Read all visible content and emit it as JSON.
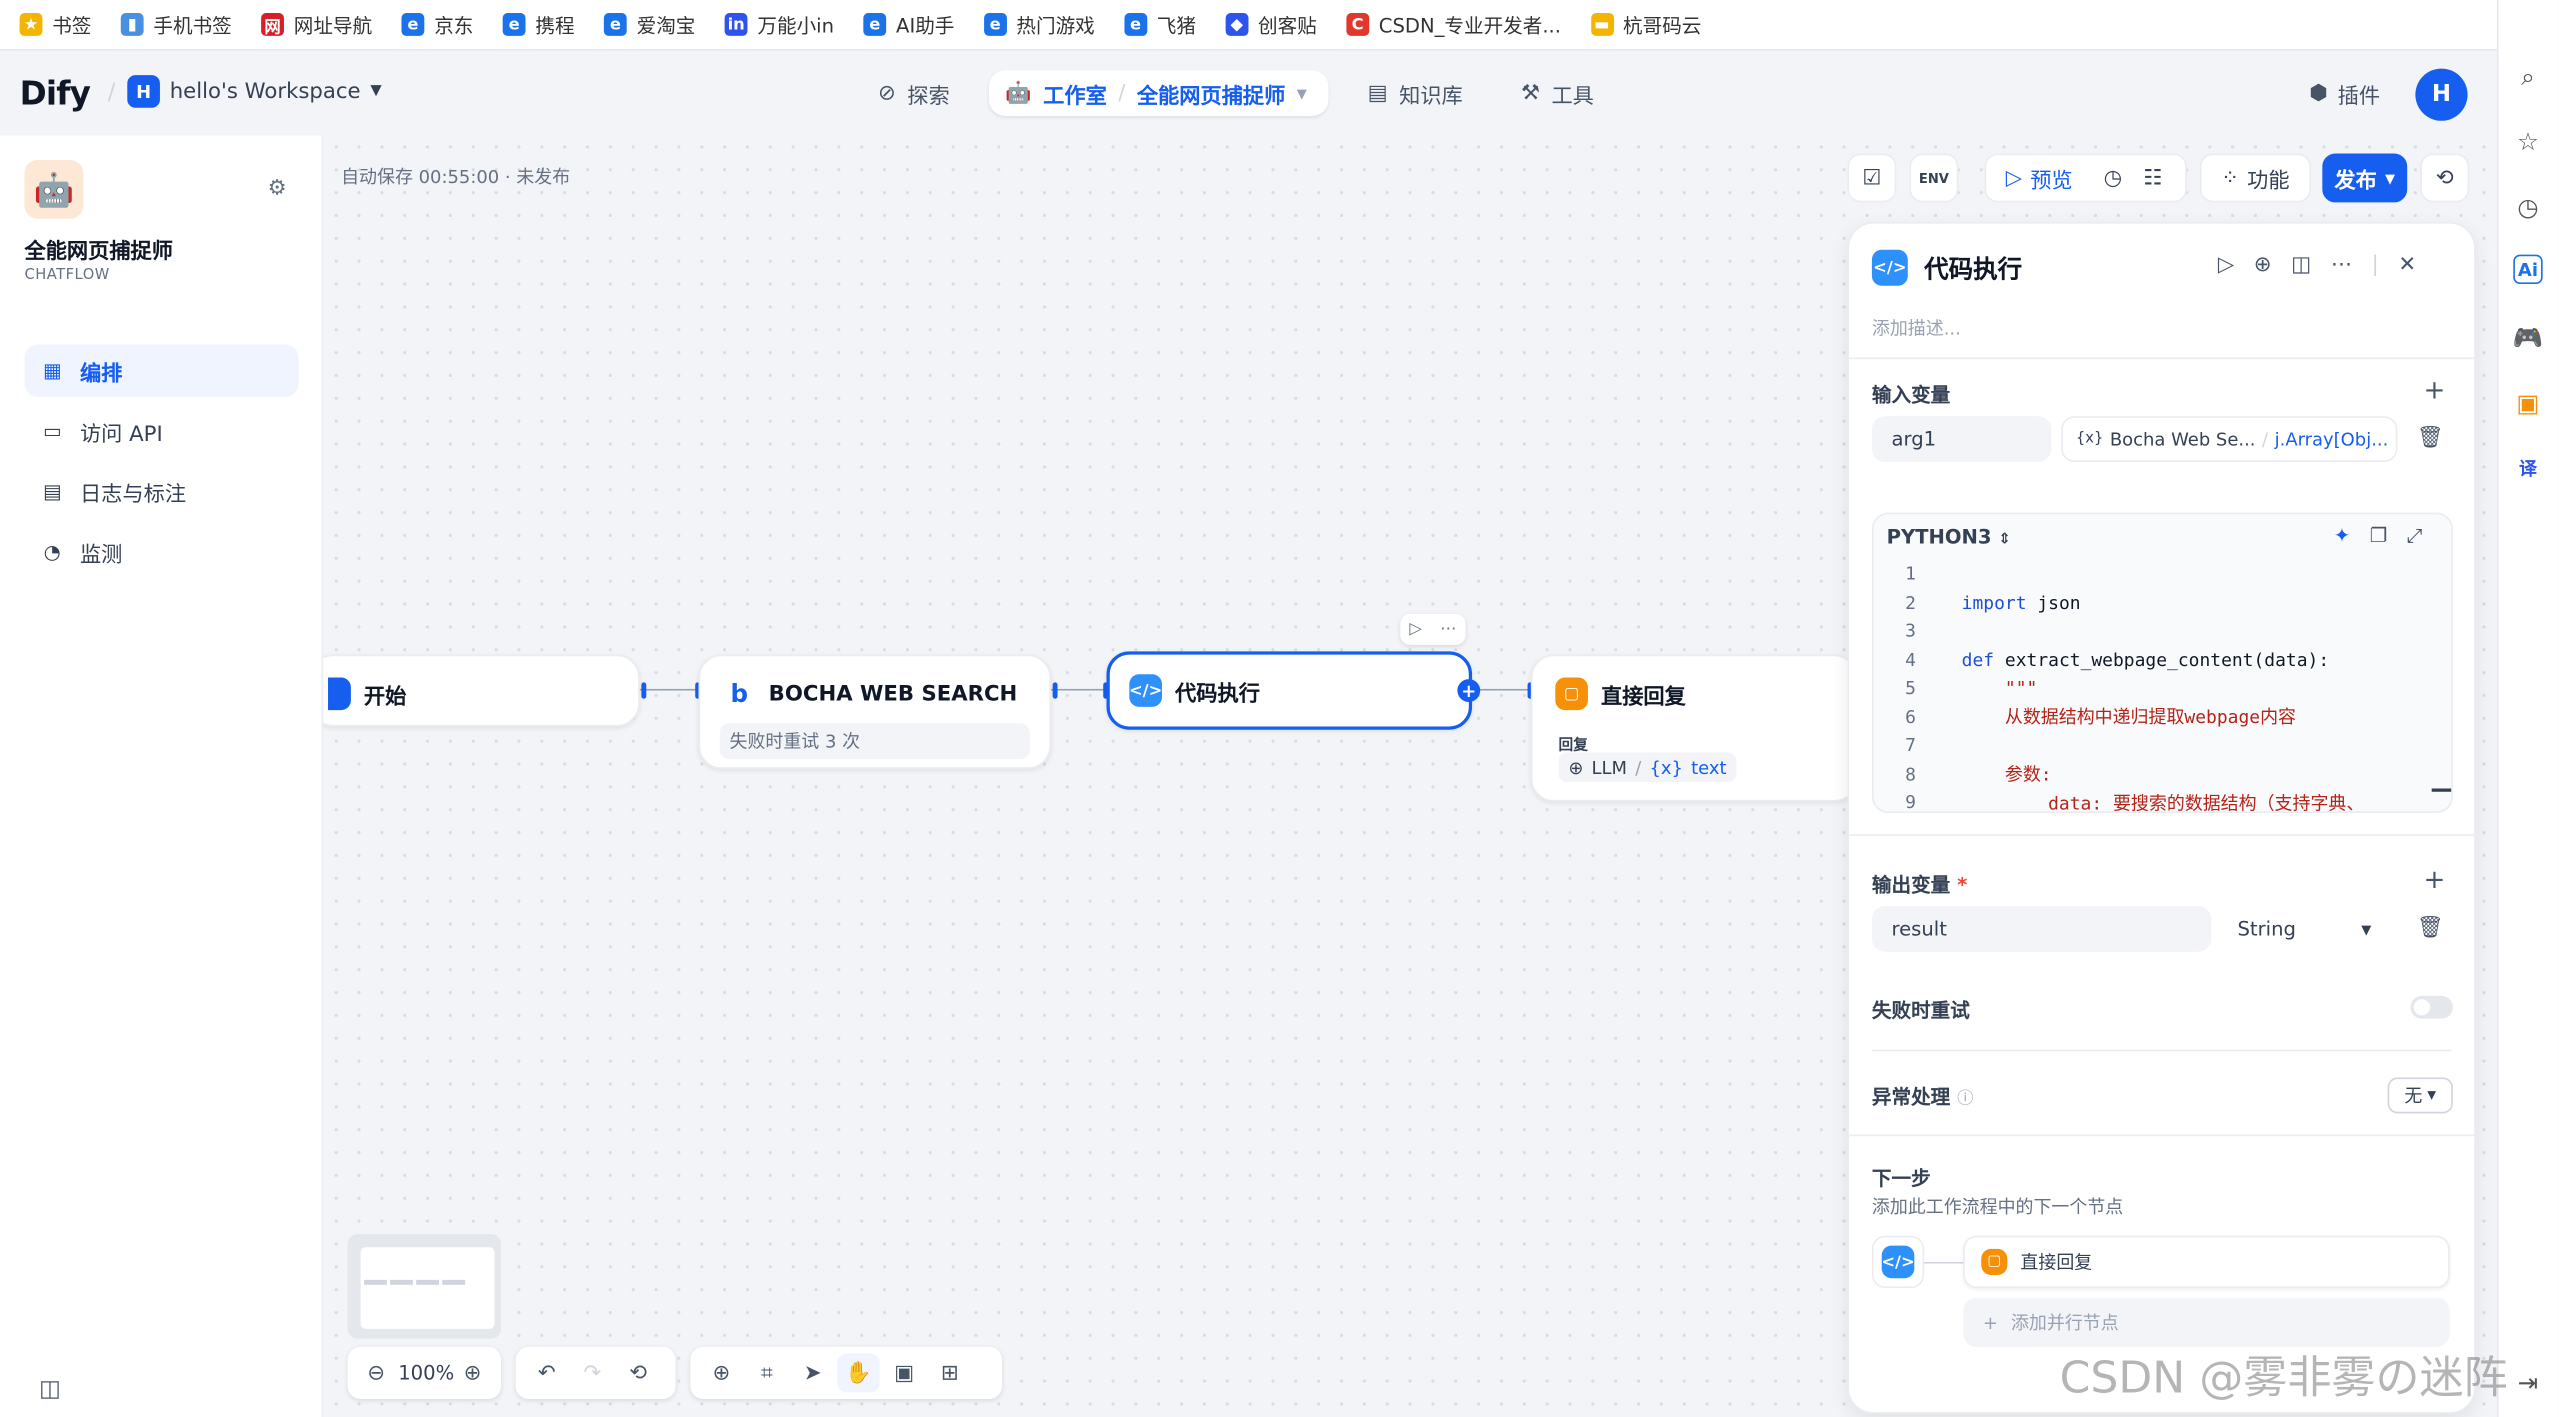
{
  "bookmarks": [
    {
      "label": "书签",
      "color": "#f5b400",
      "glyph": "★"
    },
    {
      "label": "手机书签",
      "color": "#4a90e2",
      "glyph": "▮"
    },
    {
      "label": "网址导航",
      "color": "#d91f26",
      "glyph": "网"
    },
    {
      "label": "京东",
      "color": "#1a73e8",
      "glyph": "e"
    },
    {
      "label": "携程",
      "color": "#1a73e8",
      "glyph": "e"
    },
    {
      "label": "爱淘宝",
      "color": "#1a73e8",
      "glyph": "e"
    },
    {
      "label": "万能小in",
      "color": "#2f54eb",
      "glyph": "in"
    },
    {
      "label": "AI助手",
      "color": "#1a73e8",
      "glyph": "e"
    },
    {
      "label": "热门游戏",
      "color": "#1a73e8",
      "glyph": "e"
    },
    {
      "label": "飞猪",
      "color": "#1a73e8",
      "glyph": "e"
    },
    {
      "label": "创客贴",
      "color": "#2f54eb",
      "glyph": "◆"
    },
    {
      "label": "CSDN_专业开发者...",
      "color": "#e0382c",
      "glyph": "C"
    },
    {
      "label": "杭哥码云",
      "color": "#f5b400",
      "glyph": "▬"
    }
  ],
  "header": {
    "logo": "Dify",
    "workspace_badge": "H",
    "workspace_name": "hello's Workspace",
    "nav": {
      "explore": "探索",
      "studio": "工作室",
      "current_app": "全能网页捕捉师",
      "knowledge": "知识库",
      "tools": "工具"
    },
    "plugins": "插件",
    "avatar": "H"
  },
  "sidebar": {
    "app_name": "全能网页捕捉师",
    "app_type": "CHATFLOW",
    "items": [
      {
        "label": "编排"
      },
      {
        "label": "访问 API"
      },
      {
        "label": "日志与标注"
      },
      {
        "label": "监测"
      }
    ]
  },
  "canvas": {
    "autosave": "自动保存 00:55:00 · 未发布",
    "nodes": {
      "start": {
        "title": "开始"
      },
      "bocha": {
        "title": "BOCHA WEB SEARCH",
        "sub": "失败时重试 3 次"
      },
      "code": {
        "title": "代码执行"
      },
      "answer": {
        "title": "直接回复",
        "reply_label": "回复",
        "ref_llm": "LLM",
        "ref_var": "text"
      }
    },
    "zoom": "100%"
  },
  "controls": {
    "preview": "预览",
    "features": "功能",
    "publish": "发布"
  },
  "panel": {
    "title": "代码执行",
    "desc_placeholder": "添加描述...",
    "input_label": "输入变量",
    "input_var": "arg1",
    "input_ref_node": "Bocha Web Se...",
    "input_ref_path": "j.Array[Obj...",
    "code_lang": "PYTHON3",
    "code_lines": [
      {
        "n": "1",
        "t": ""
      },
      {
        "n": "2",
        "t": "import json",
        "cls": "import"
      },
      {
        "n": "3",
        "t": ""
      },
      {
        "n": "4",
        "t": "def extract_webpage_content(data):",
        "cls": "def"
      },
      {
        "n": "5",
        "t": "    \"\"\"",
        "cls": "str"
      },
      {
        "n": "6",
        "t": "    从数据结构中递归提取webpage内容",
        "cls": "str"
      },
      {
        "n": "7",
        "t": ""
      },
      {
        "n": "8",
        "t": "    参数:",
        "cls": "str"
      },
      {
        "n": "9",
        "t": "        data: 要搜索的数据结构（支持字典、",
        "cls": "str"
      }
    ],
    "output_label": "输出变量",
    "output_required": "*",
    "output_var": "result",
    "output_type": "String",
    "retry_label": "失败时重试",
    "error_label": "异常处理",
    "error_value": "无",
    "next_label": "下一步",
    "next_desc": "添加此工作流程中的下一个节点",
    "next_node": "直接回复",
    "add_parallel": "添加并行节点"
  },
  "watermark": "CSDN @雾非雾の迷阵",
  "colors": {
    "accent": "#155eef",
    "answer_node": "#f79009",
    "code_node": "#2e90fa"
  }
}
